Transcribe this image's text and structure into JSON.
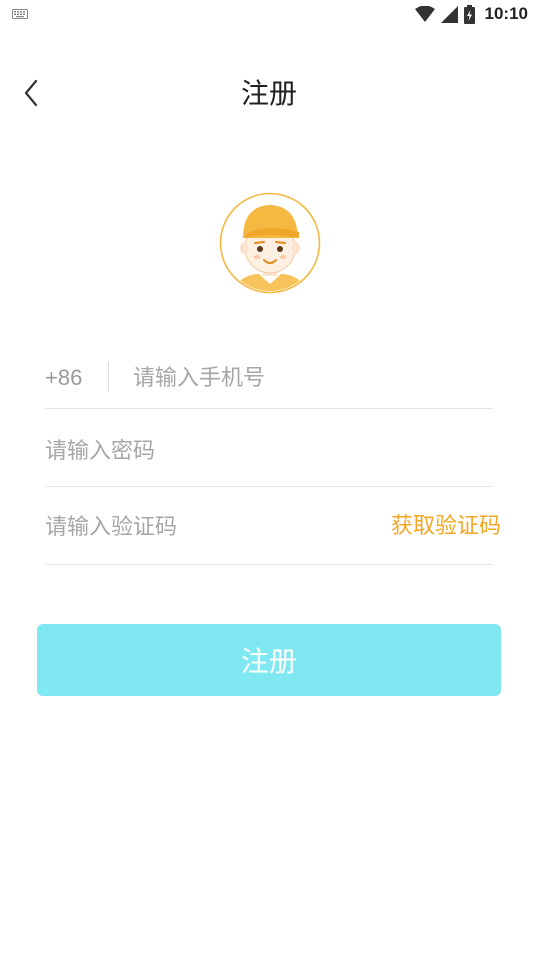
{
  "status_bar": {
    "time": "10:10",
    "icons": [
      "keyboard-icon",
      "wifi-icon",
      "signal-icon",
      "battery-charging-icon"
    ]
  },
  "header": {
    "back_icon": "chevron-left-icon",
    "title": "注册"
  },
  "avatar": {
    "icon": "boy-with-cap-avatar",
    "colors": {
      "ring": "#f5b942",
      "cap": "#f5b942",
      "skin": "#fdf0e3"
    }
  },
  "form": {
    "phone": {
      "country_code": "+86",
      "placeholder": "请输入手机号",
      "value": ""
    },
    "password": {
      "placeholder": "请输入密码",
      "value": ""
    },
    "verification_code": {
      "placeholder": "请输入验证码",
      "value": "",
      "get_code_label": "获取验证码"
    }
  },
  "register_button": {
    "label": "注册"
  },
  "colors": {
    "accent": "#f5a623",
    "button_bg": "#80e8f0",
    "button_text": "#ffffff",
    "placeholder": "#a6a6a6",
    "divider": "#e6e6e6"
  }
}
